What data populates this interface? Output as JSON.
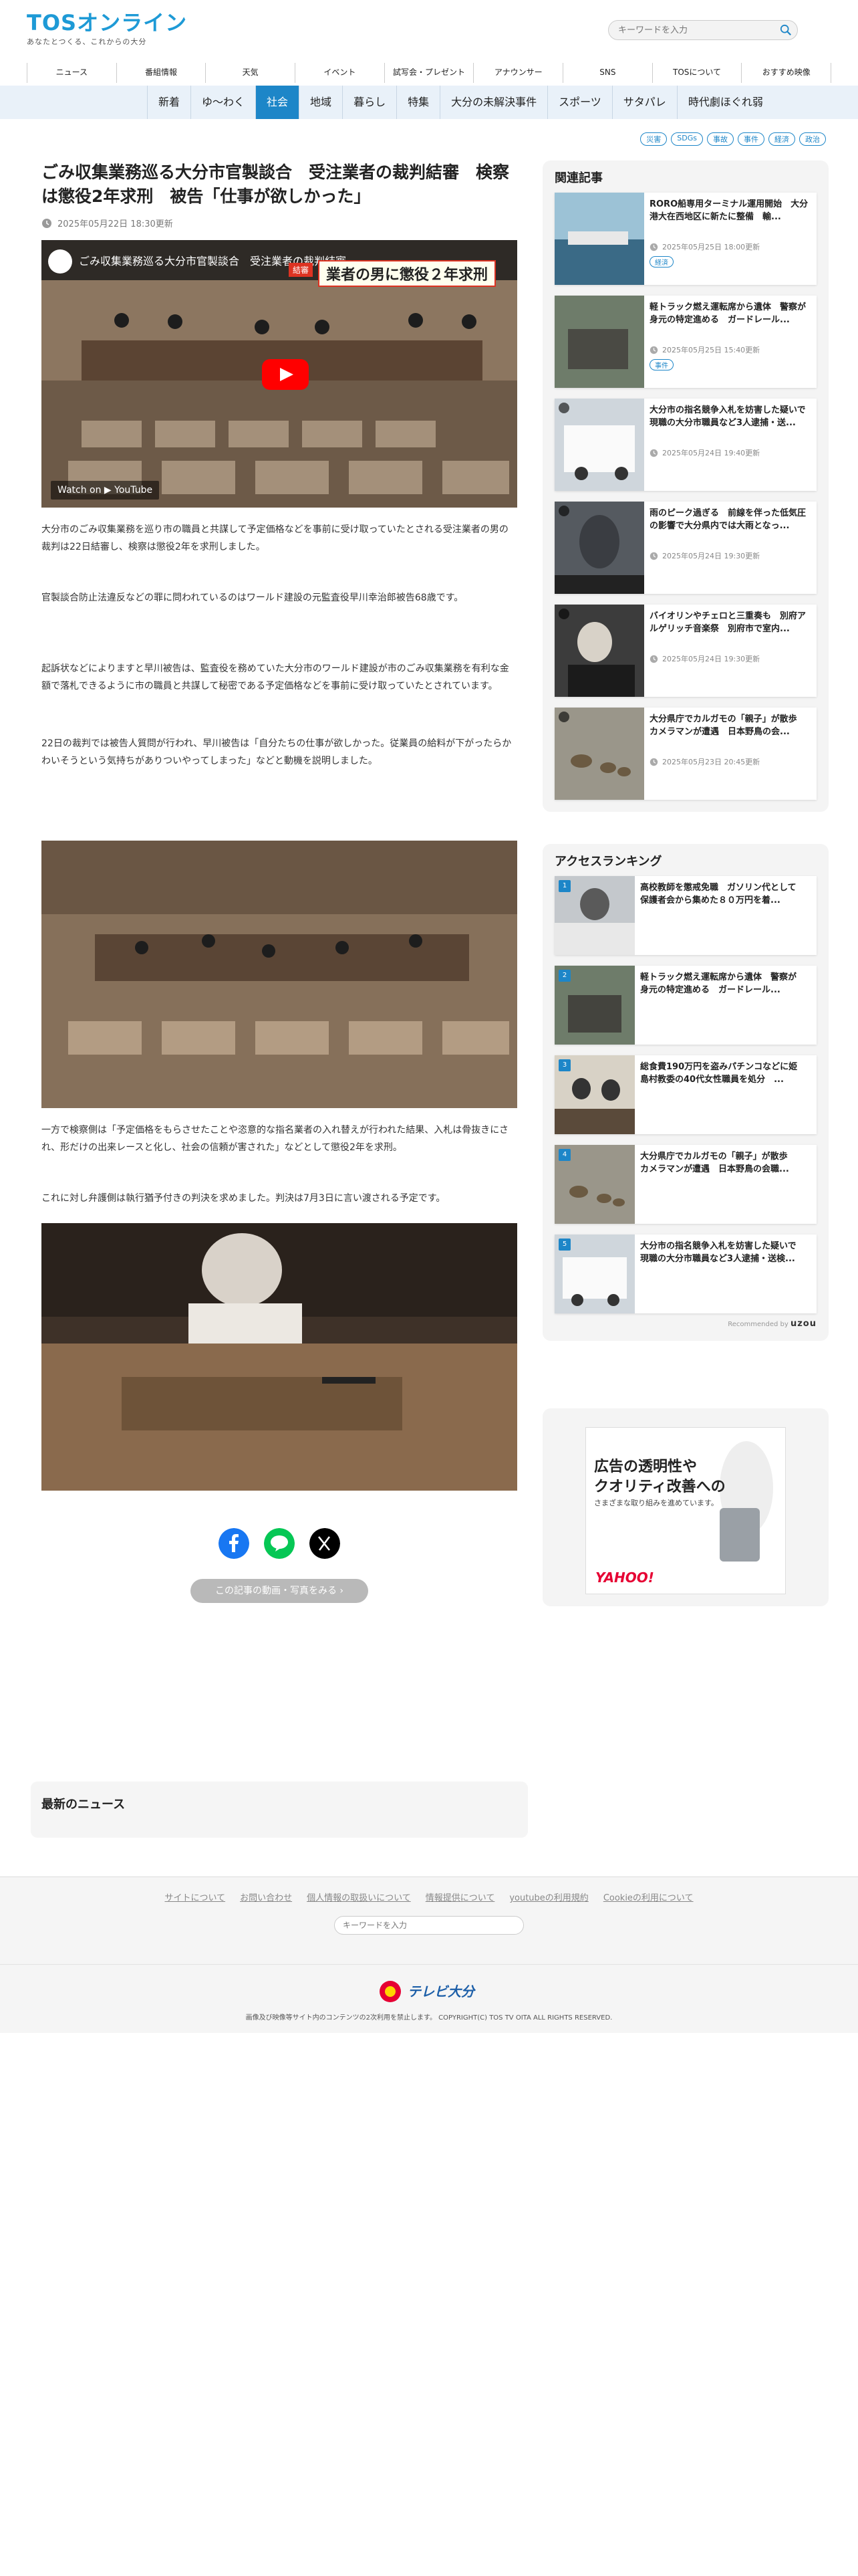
{
  "header": {
    "logo_text": "TOSオンライン",
    "logo_tagline": "あなたとつくる、これからの大分",
    "search_placeholder": "キーワードを入力"
  },
  "top_nav": [
    "ニュース",
    "番組情報",
    "天気",
    "イベント",
    "試写会・プレゼント",
    "アナウンサー",
    "SNS",
    "TOSについて",
    "おすすめ映像"
  ],
  "category_nav": {
    "items": [
      "新着",
      "ゆ〜わく",
      "社会",
      "地域",
      "暮らし",
      "特集",
      "大分の未解決事件",
      "スポーツ",
      "サタパレ",
      "時代劇ほぐれ弱"
    ],
    "active": "社会"
  },
  "tags": [
    "災害",
    "SDGs",
    "事故",
    "事件",
    "経済",
    "政治"
  ],
  "article": {
    "title": "ごみ収集業務巡る大分市官製談合　受注業者の裁判結審　検察は懲役2年求刑　被告「仕事が欲しかった」",
    "date": "2025年05月22日 18:30更新",
    "video": {
      "title": "ごみ収集業務巡る大分市官製談合　受注業者の裁判結審",
      "badge": "結審",
      "banner": "業者の男に懲役２年求刑",
      "watch_on": "Watch on ▶ YouTube"
    },
    "paragraphs": [
      "大分市のごみ収集業務を巡り市の職員と共謀して予定価格などを事前に受け取っていたとされる受注業者の男の裁判は22日結審し、検察は懲役2年を求刑しました。",
      "官製談合防止法違反などの罪に問われているのはワールド建設の元監査役早川幸治郎被告68歳です。",
      "起訴状などによりますと早川被告は、監査役を務めていた大分市のワールド建設が市のごみ収集業務を有利な金額で落札できるように市の職員と共謀して秘密である予定価格などを事前に受け取っていたとされています。",
      "22日の裁判では被告人質問が行われ、早川被告は「自分たちの仕事が欲しかった。従業員の給料が下がったらかわいそうという気持ちがありついやってしまった」などと動機を説明しました。",
      "一方で検察側は「予定価格をもらさせたことや恣意的な指名業者の入れ替えが行われた結果、入札は骨抜きにされ、形だけの出来レースと化し、社会の信頼が害された」などとして懲役2年を求刑。",
      "これに対し弁護側は執行猶予付きの判決を求めました。判決は7月3日に言い渡される予定です。"
    ],
    "gallery_button": "この記事の動画・写真をみる"
  },
  "related": {
    "heading": "関連記事",
    "items": [
      {
        "title": "RORO船専用ターミナル運用開始　大分港大在西地区に新たに整備　輸...",
        "date": "2025年05月25日 18:00更新",
        "tag": "経済"
      },
      {
        "title": "軽トラック燃え運転席から遺体　警察が身元の特定進める　ガードレール...",
        "date": "2025年05月25日 15:40更新",
        "tag": "事件"
      },
      {
        "title": "大分市の指名競争入札を妨害した疑いで現職の大分市職員など3人逮捕・送...",
        "date": "2025年05月24日 19:40更新",
        "tag": ""
      },
      {
        "title": "雨のピーク過ぎる　前線を伴った低気圧の影響で大分県内では大雨となっ...",
        "date": "2025年05月24日 19:30更新",
        "tag": ""
      },
      {
        "title": "バイオリンやチェロと三重奏も　別府アルゲリッチ音楽祭　別府市で室内...",
        "date": "2025年05月24日 19:30更新",
        "tag": ""
      },
      {
        "title": "大分県庁でカルガモの「親子」が散歩　カメラマンが遭遇　日本野鳥の会...",
        "date": "2025年05月23日 20:45更新",
        "tag": ""
      }
    ]
  },
  "ranking": {
    "heading": "アクセスランキング",
    "items": [
      {
        "rank": "1",
        "title": "高校教師を懲戒免職　ガソリン代として保護者会から集めた８０万円を着..."
      },
      {
        "rank": "2",
        "title": "軽トラック燃え運転席から遺体　警察が身元の特定進める　ガードレール..."
      },
      {
        "rank": "3",
        "title": "総食費190万円を盗みパチンコなどに姫島村教委の40代女性職員を処分　..."
      },
      {
        "rank": "4",
        "title": "大分県庁でカルガモの「親子」が散歩　カメラマンが遭遇　日本野鳥の会職..."
      },
      {
        "rank": "5",
        "title": "大分市の指名競争入札を妨害した疑いで現職の大分市職員など3人逮捕・送検..."
      }
    ],
    "recommended_prefix": "Recommended by",
    "recommended_brand": "uzou"
  },
  "ad": {
    "line1": "広告の透明性や",
    "line2": "クオリティ改善への",
    "line3": "さまざまな取り組みを進めています。",
    "brand": "YAHOO!"
  },
  "latest": {
    "heading": "最新のニュース"
  },
  "footer": {
    "links": [
      "サイトについて",
      "お問い合わせ",
      "個人情報の取扱いについて",
      "情報提供について",
      "youtubeの利用規約",
      "Cookieの利用について"
    ],
    "search_placeholder": "キーワードを入力",
    "logo_text": "テレビ大分",
    "copyright": "画像及び映像等サイト内のコンテンツの2次利用を禁止します。 COPYRIGHT(C) TOS TV OITA ALL RIGHTS RESERVED."
  },
  "colors": {
    "accent": "#1d86c8",
    "logo": "#1e9ad6",
    "nav_bg": "#e9f1f9"
  }
}
